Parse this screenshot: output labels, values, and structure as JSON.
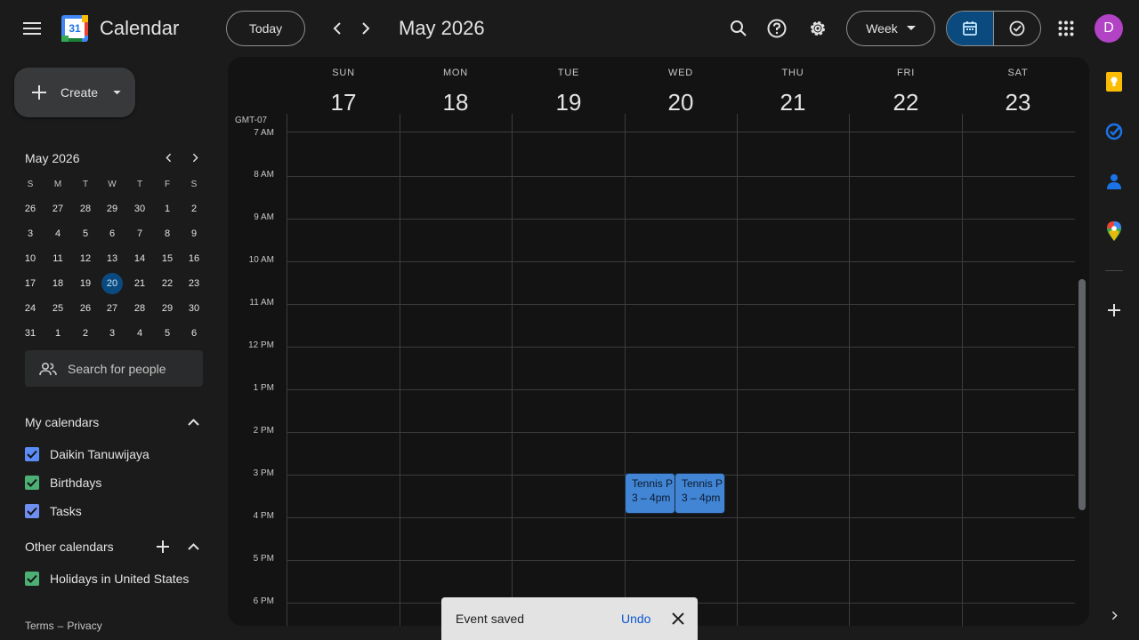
{
  "header": {
    "app_title": "Calendar",
    "logo_day": "31",
    "today_label": "Today",
    "month_label": "May 2026",
    "view_label": "Week",
    "avatar_letter": "D"
  },
  "create": {
    "label": "Create"
  },
  "mini_calendar": {
    "title": "May 2026",
    "weekday_heads": [
      "S",
      "M",
      "T",
      "W",
      "T",
      "F",
      "S"
    ],
    "weeks": [
      [
        "26",
        "27",
        "28",
        "29",
        "30",
        "1",
        "2"
      ],
      [
        "3",
        "4",
        "5",
        "6",
        "7",
        "8",
        "9"
      ],
      [
        "10",
        "11",
        "12",
        "13",
        "14",
        "15",
        "16"
      ],
      [
        "17",
        "18",
        "19",
        "20",
        "21",
        "22",
        "23"
      ],
      [
        "24",
        "25",
        "26",
        "27",
        "28",
        "29",
        "30"
      ],
      [
        "31",
        "1",
        "2",
        "3",
        "4",
        "5",
        "6"
      ]
    ],
    "selected": "20"
  },
  "search_people": {
    "placeholder": "Search for people"
  },
  "my_calendars": {
    "title": "My calendars",
    "items": [
      {
        "label": "Daikin Tanuwijaya",
        "color": "#5b8cf5"
      },
      {
        "label": "Birthdays",
        "color": "#4caf73"
      },
      {
        "label": "Tasks",
        "color": "#6f8ff0"
      }
    ]
  },
  "other_calendars": {
    "title": "Other calendars",
    "items": [
      {
        "label": "Holidays in United States",
        "color": "#4caf73"
      }
    ]
  },
  "footer": {
    "terms": "Terms",
    "sep": "–",
    "privacy": "Privacy"
  },
  "week": {
    "timezone": "GMT-07",
    "days": [
      {
        "name": "SUN",
        "num": "17"
      },
      {
        "name": "MON",
        "num": "18"
      },
      {
        "name": "TUE",
        "num": "19"
      },
      {
        "name": "WED",
        "num": "20"
      },
      {
        "name": "THU",
        "num": "21"
      },
      {
        "name": "FRI",
        "num": "22"
      },
      {
        "name": "SAT",
        "num": "23"
      }
    ],
    "hours": [
      "7 AM",
      "8 AM",
      "9 AM",
      "10 AM",
      "11 AM",
      "12 PM",
      "1 PM",
      "2 PM",
      "3 PM",
      "4 PM",
      "5 PM",
      "6 PM"
    ]
  },
  "events": [
    {
      "title": "Tennis P",
      "time": "3 – 4pm"
    },
    {
      "title": "Tennis P",
      "time": "3 – 4pm"
    }
  ],
  "snackbar": {
    "message": "Event saved",
    "action": "Undo"
  },
  "colors": {
    "accent": "#0b57d0",
    "selected_day": "#0b4a7f",
    "event": "#4285d4",
    "avatar": "#b143c4"
  }
}
